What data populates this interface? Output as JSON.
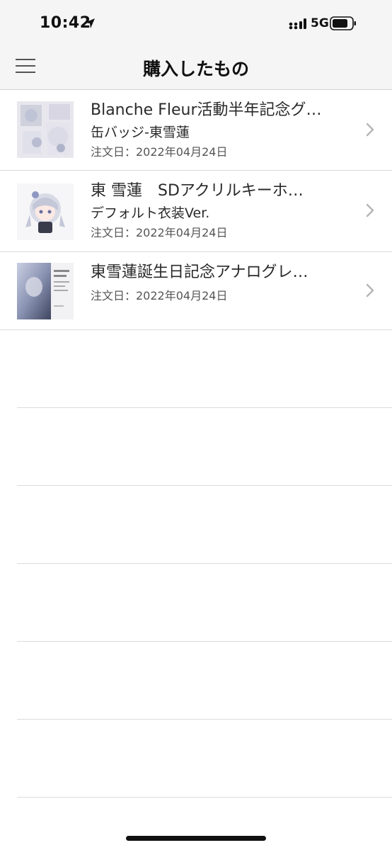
{
  "status_bar": {
    "time": "10:42",
    "network": "5G"
  },
  "nav": {
    "title": "購入したもの"
  },
  "purchases": [
    {
      "title": "Blanche Fleur活動半年記念グ…",
      "subtitle": "缶バッジ-東雪蓮",
      "date": "注文日：2022年04月24日",
      "thumbnail_icon": "badge-thumbnail"
    },
    {
      "title": "東 雪蓮　SDアクリルキーホ…",
      "subtitle": "デフォルト衣装Ver.",
      "date": "注文日：2022年04月24日",
      "thumbnail_icon": "acrylic-keychain-thumbnail"
    },
    {
      "title": "東雪蓮誕生日記念アナログレ…",
      "subtitle": "",
      "date": "注文日：2022年04月24日",
      "thumbnail_icon": "birthday-record-thumbnail"
    }
  ]
}
